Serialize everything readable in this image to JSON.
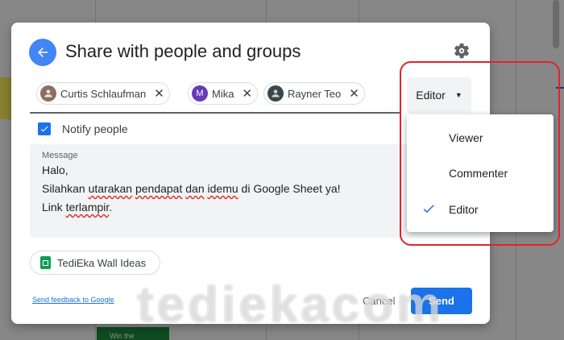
{
  "background": {
    "cell_text": "Win the"
  },
  "dialog": {
    "title": "Share with people and groups",
    "people": [
      {
        "name": "Curtis Schlaufman",
        "avatar": ""
      },
      {
        "name": "Mika",
        "avatar": "M"
      },
      {
        "name": "Rayner Teo",
        "avatar": ""
      }
    ],
    "role_button": "Editor",
    "notify_label": "Notify people",
    "message_label": "Message",
    "message": {
      "line1": "Halo,",
      "line2a": "Silahkan ",
      "line2b": "utarakan",
      "line2c": " ",
      "line2d": "pendapat",
      "line2e": " ",
      "line2f": "dan",
      "line2g": " ",
      "line2h": "idemu",
      "line2i": " di Google Sheet ya!",
      "line3a": "Link ",
      "line3b": "terlampir",
      "line3c": "."
    },
    "file_name": "TediEka Wall Ideas",
    "feedback_link": "Send feedback to Google",
    "cancel_label": "Cancel",
    "send_label": "Send"
  },
  "role_menu": {
    "items": [
      "Viewer",
      "Commenter",
      "Editor"
    ],
    "selected": "Editor"
  },
  "watermark": "tediekacom",
  "colors": {
    "accent": "#1a73e8",
    "highlight": "#e0242b",
    "sheet_green": "#0f9d58",
    "mika_avatar": "#673ab7"
  }
}
